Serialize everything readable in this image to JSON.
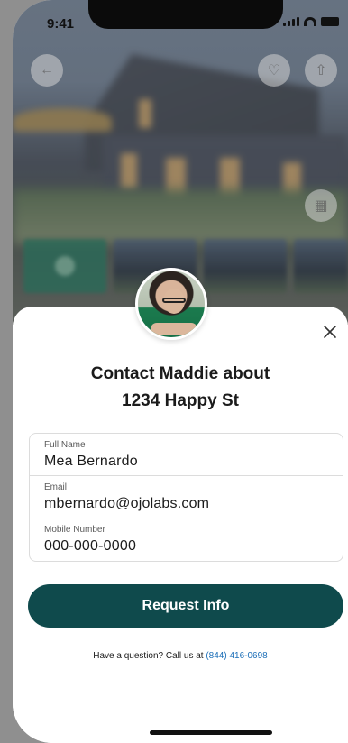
{
  "status_bar": {
    "time": "9:41"
  },
  "hero": {
    "back_icon": "arrow-left-icon",
    "favorite_icon": "heart-icon",
    "share_icon": "share-icon",
    "gallery_icon": "grid-icon"
  },
  "contact_sheet": {
    "title_line1": "Contact Maddie about",
    "title_line2": "1234 Happy St",
    "close_icon": "close-icon",
    "fields": [
      {
        "label": "Full Name",
        "value": "Mea Bernardo"
      },
      {
        "label": "Email",
        "value": "mbernardo@ojolabs.com"
      },
      {
        "label": "Mobile Number",
        "value": "000-000-0000"
      }
    ],
    "cta_label": "Request Info",
    "question_text": "Have a question? Call us at",
    "phone_link": "(844) 416-0698"
  },
  "colors": {
    "cta_bg": "#0f4a4c",
    "link": "#1c6fb8"
  }
}
